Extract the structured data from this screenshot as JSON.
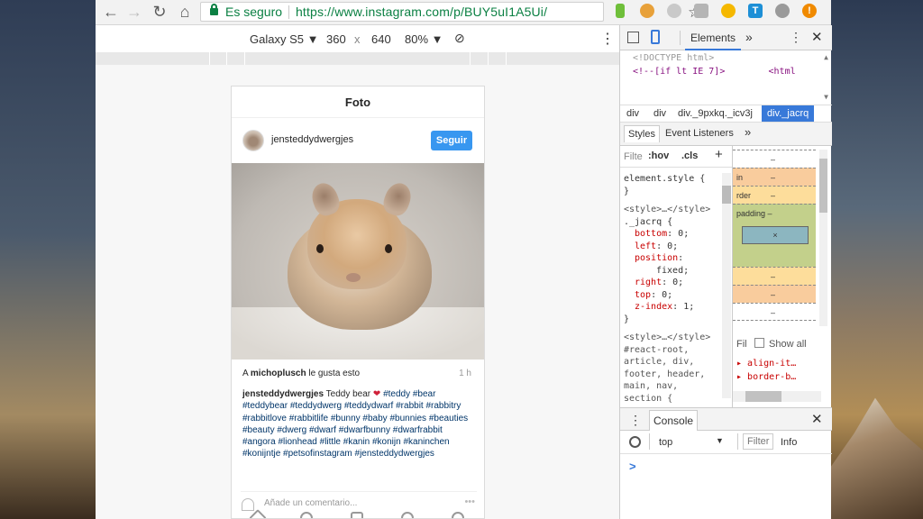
{
  "browser": {
    "secure_label": "Es seguro",
    "url": "https://www.instagram.com/p/BUY5uI1A5Ui/"
  },
  "device_toolbar": {
    "device": "Galaxy S5",
    "width": "360",
    "times": "x",
    "height": "640",
    "zoom": "80%"
  },
  "instagram": {
    "header_title": "Foto",
    "username": "jensteddydwergjes",
    "follow_label": "Seguir",
    "likes_prefix": "A ",
    "likes_user": "michoplusch",
    "likes_suffix": " le gusta esto",
    "age": "1 h",
    "caption_user": "jensteddydwergjes",
    "caption_text": " Teddy bear ",
    "caption_emoji": "❤",
    "hashtags": "#teddy #bear #teddybear #teddydwerg #teddydwarf #rabbit #rabbitry #rabbitlove #rabbitlife #bunny #baby #bunnies #beauties #beauty #dwerg #dwarf #dwarfbunny #dwarfrabbit #angora #lionhead #little #kanin #konijn #kaninchen #konijntje #petsofinstagram #jensteddydwergjes",
    "comment_placeholder": "Añade un comentario...",
    "more": "•••"
  },
  "devtools": {
    "tab_elements": "Elements",
    "more_tabs": "»",
    "source": [
      "<!DOCTYPE html>",
      "<!--[if lt IE 7]>        <html"
    ],
    "breadcrumbs": [
      "div",
      "div",
      "div._9pxkq._icv3j",
      "div._jacrq"
    ],
    "tab_styles": "Styles",
    "tab_event_listeners": "Event Listeners",
    "filter_label": "Filte",
    "hov": ":hov",
    "cls": ".cls",
    "add": "+",
    "element_style": "element.style {",
    "close_brace": "}",
    "style_tag": "<style>…</style>",
    "jacrq_selector": "._jacrq {",
    "props": [
      {
        "name": "bottom",
        "value": "0;"
      },
      {
        "name": "left",
        "value": "0;"
      },
      {
        "name": "position",
        "value": ""
      },
      {
        "name": "",
        "value": "fixed;"
      },
      {
        "name": "right",
        "value": "0;"
      },
      {
        "name": "top",
        "value": "0;"
      },
      {
        "name": "z-index",
        "value": "1;"
      }
    ],
    "style_tag2": "<style>…</style>",
    "react_selector": "#react-root,",
    "react_selector2": "article, div,",
    "react_selector3": "footer, header,",
    "react_selector4": "main, nav,",
    "react_selector5": "section {",
    "box_model": {
      "dash": "–",
      "margin": "in",
      "border": "rder",
      "padding": "padding –",
      "content": "×"
    },
    "computed_filter": "Fil",
    "show_all": "Show all",
    "computed_props": [
      "align-it…",
      "border-b…"
    ],
    "console_label": "Console",
    "console_context": "top",
    "console_filter": "Filter",
    "console_level": "Info",
    "console_prompt": ">"
  },
  "colors": {
    "secure_green": "#0b8043",
    "ig_blue": "#3897f0",
    "devtools_selected": "#3879d9",
    "box_margin": "#f9cc9d",
    "box_border": "#fddd9b",
    "box_padding": "#c3d08b",
    "box_content": "#8cb6c0"
  }
}
